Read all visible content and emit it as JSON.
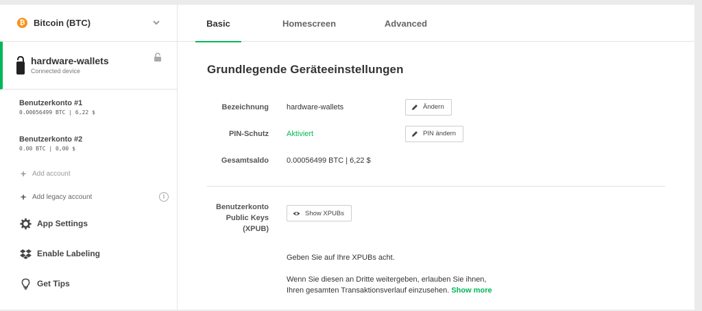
{
  "coin": {
    "symbol": "₿",
    "label": "Bitcoin (BTC)"
  },
  "device": {
    "name": "hardware-wallets",
    "status": "Connected device"
  },
  "accounts": [
    {
      "name": "Benutzerkonto #1",
      "balance": "0.00056499 BTC | 6,22 $"
    },
    {
      "name": "Benutzerkonto #2",
      "balance": "0.00 BTC | 0,00 $"
    }
  ],
  "add_account": "Add account",
  "add_legacy_account": "Add legacy account",
  "info_symbol": "i",
  "menu": [
    {
      "label": "App Settings",
      "icon": "gear-icon"
    },
    {
      "label": "Enable Labeling",
      "icon": "dropbox-icon"
    },
    {
      "label": "Get Tips",
      "icon": "lightbulb-icon"
    }
  ],
  "tabs": [
    {
      "label": "Basic",
      "active": true
    },
    {
      "label": "Homescreen",
      "active": false
    },
    {
      "label": "Advanced",
      "active": false
    }
  ],
  "main": {
    "title": "Grundlegende Geräteeinstellungen",
    "rows": [
      {
        "label": "Bezeichnung",
        "value": "hardware-wallets",
        "button": "Ändern"
      },
      {
        "label": "PIN-Schutz",
        "value": "Aktiviert",
        "button": "PIN ändern"
      },
      {
        "label": "Gesamtsaldo",
        "value": "0.00056499 BTC | 6,22 $"
      }
    ],
    "xpub": {
      "label_line1": "Benutzerkonto",
      "label_line2": "Public Keys",
      "label_line3": "(XPUB)",
      "button": "Show XPUBs",
      "note1": "Geben Sie auf Ihre XPUBs acht.",
      "note2_line1": "Wenn Sie diesen an Dritte weitergeben, erlauben Sie ihnen,",
      "note2_line2": "Ihren gesamten Transaktionsverlauf einzusehen.",
      "show_more": "Show more"
    }
  },
  "colors": {
    "accent": "#01b757",
    "bitcoin": "#f7931a"
  }
}
